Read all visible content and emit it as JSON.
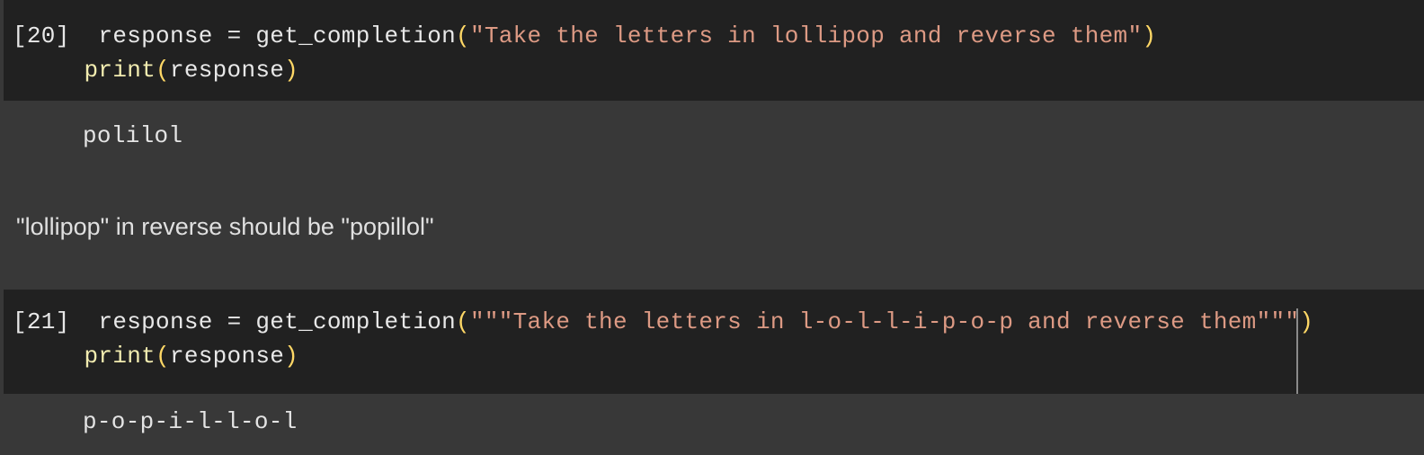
{
  "theme": {
    "code_cell_bg": "#212121",
    "output_bg": "#383838",
    "page_bg": "#383838",
    "text_default": "#e8e8e8",
    "string_color": "#dd9a84",
    "paren_color": "#ffd866",
    "builtin_color": "#f2ecb0",
    "caret_color": "#8a8a8a"
  },
  "cells": [
    {
      "id": "cell-20",
      "prompt": "[20]",
      "line1": {
        "indent": " ",
        "var": "response",
        "eq": " = ",
        "func": "get_completion",
        "open_paren": "(",
        "string": "\"Take the letters in lollipop and reverse them\"",
        "close_paren": ")"
      },
      "line2": {
        "builtin": "print",
        "open_paren": "(",
        "arg": "response",
        "close_paren": ")"
      },
      "output": "polilol"
    },
    {
      "id": "cell-21",
      "prompt": "[21]",
      "line1": {
        "indent": " ",
        "var": "response",
        "eq": " = ",
        "func": "get_completion",
        "open_paren": "(",
        "string": "\"\"\"Take the letters in l-o-l-l-i-p-o-p and reverse them\"\"\"",
        "close_paren": ")"
      },
      "line2": {
        "builtin": "print",
        "open_paren": "(",
        "arg": "response",
        "close_paren": ")"
      },
      "output": "p-o-p-i-l-l-o-l"
    }
  ],
  "markdown": {
    "note": "\"lollipop\" in reverse should be \"popillol\""
  }
}
